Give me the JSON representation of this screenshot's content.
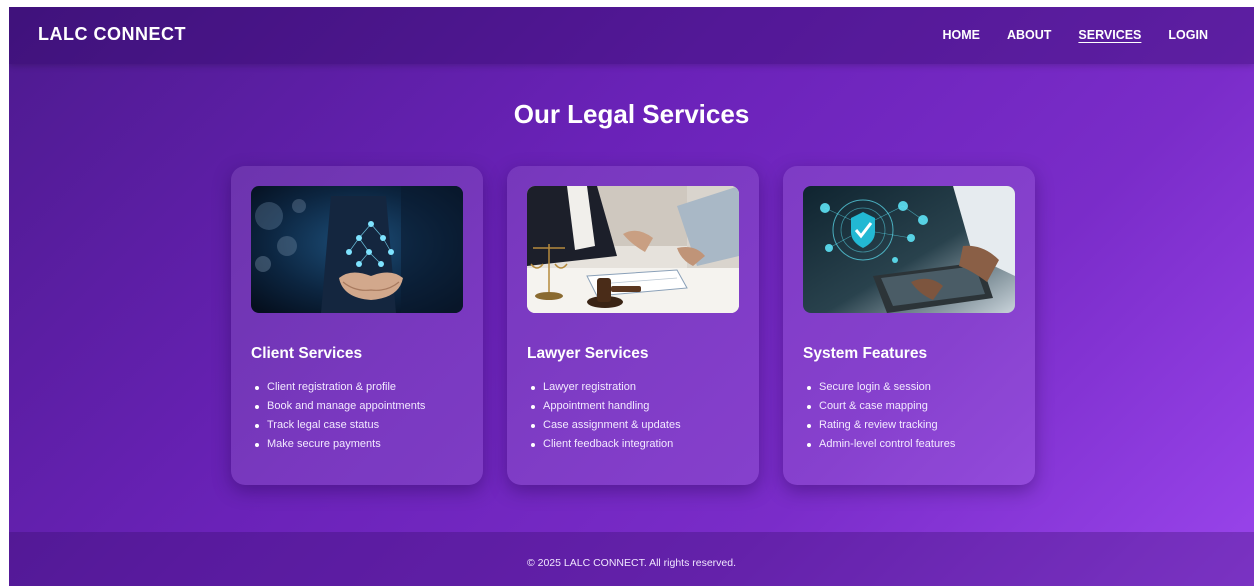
{
  "brand": "LALC CONNECT",
  "nav": {
    "home": "HOME",
    "about": "ABOUT",
    "services": "SERVICES",
    "login": "LOGIN"
  },
  "page_title": "Our Legal Services",
  "cards": [
    {
      "title": "Client Services",
      "items": [
        "Client registration & profile",
        "Book and manage appointments",
        "Track legal case status",
        "Make secure payments"
      ]
    },
    {
      "title": "Lawyer Services",
      "items": [
        "Lawyer registration",
        "Appointment handling",
        "Case assignment & updates",
        "Client feedback integration"
      ]
    },
    {
      "title": "System Features",
      "items": [
        "Secure login & session",
        "Court & case mapping",
        "Rating & review tracking",
        "Admin-level control features"
      ]
    }
  ],
  "footer": "© 2025 LALC CONNECT. All rights reserved.",
  "colors": {
    "background_start": "#4d1a8f",
    "background_end": "#9a45ec",
    "text": "#ffffff"
  }
}
